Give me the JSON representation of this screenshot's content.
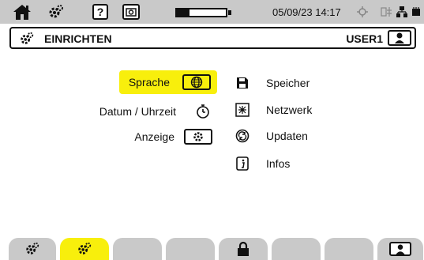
{
  "status_bar": {
    "datetime": "05/09/23 14:17",
    "battery_level": 0.25,
    "icons": [
      "home-icon",
      "gear-icon",
      "help-icon",
      "camera-icon",
      "battery-icon",
      "target-icon",
      "usb-icon",
      "network-icon",
      "memory-icon"
    ],
    "help_label": "?"
  },
  "header": {
    "title": "EINRICHTEN",
    "user": "USER1"
  },
  "menu": {
    "left": [
      {
        "label": "Sprache",
        "icon": "globe-icon",
        "selected": true
      },
      {
        "label": "Datum / Uhrzeit",
        "icon": "timer-icon",
        "selected": false
      },
      {
        "label": "Anzeige",
        "icon": "display-icon",
        "selected": false
      }
    ],
    "right": [
      {
        "label": "Speicher",
        "icon": "save-icon"
      },
      {
        "label": "Netzwerk",
        "icon": "network-icon"
      },
      {
        "label": "Updaten",
        "icon": "update-icon"
      },
      {
        "label": "Infos",
        "icon": "info-icon"
      }
    ]
  },
  "bottom_tabs": [
    "settings-tab",
    "setup-tab-active",
    "empty",
    "empty",
    "lock-tab",
    "empty",
    "empty",
    "user-tab"
  ],
  "colors": {
    "accent": "#f8ef0c",
    "bar": "#c9c9c9"
  }
}
